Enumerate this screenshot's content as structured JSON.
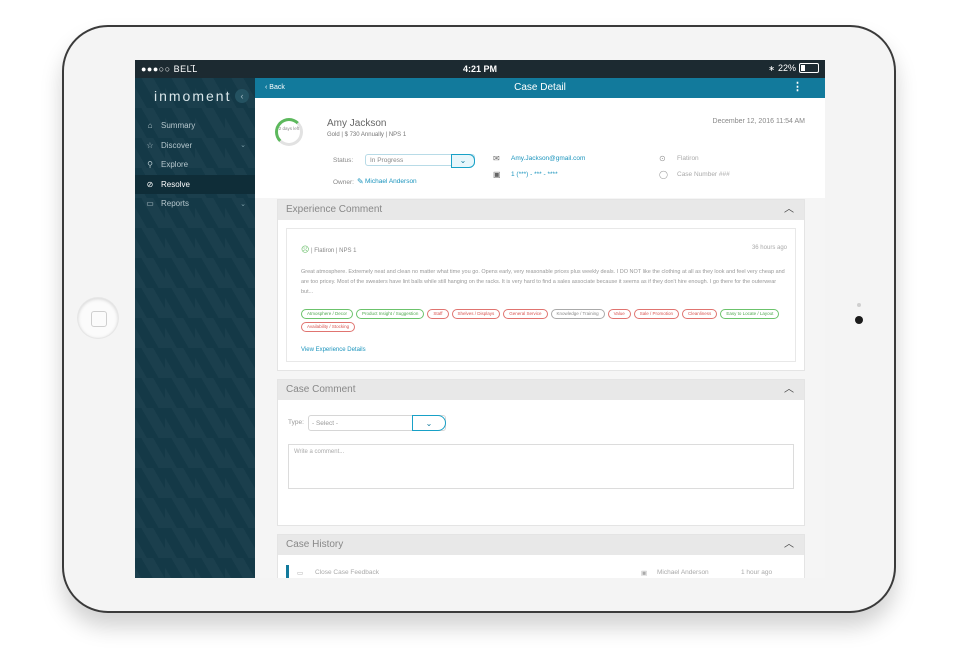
{
  "status_bar": {
    "carrier": "●●●○○ BELL",
    "wifi_icon": "wifi-icon",
    "time": "4:21 PM",
    "battery": "22%",
    "battery_level": 0.22
  },
  "sidebar": {
    "brand": "inmoment",
    "collapse_icon": "chevron-left-icon",
    "items": [
      {
        "label": "Summary",
        "icon": "home-icon",
        "active": false,
        "expandable": false
      },
      {
        "label": "Discover",
        "icon": "star-icon",
        "active": false,
        "expandable": true
      },
      {
        "label": "Explore",
        "icon": "flashlight-icon",
        "active": false,
        "expandable": false
      },
      {
        "label": "Resolve",
        "icon": "check-circle-icon",
        "active": true,
        "expandable": false
      },
      {
        "label": "Reports",
        "icon": "folder-icon",
        "active": false,
        "expandable": true
      }
    ]
  },
  "topbar": {
    "back": "‹ Back",
    "title": "Case Detail",
    "menu_icon": "more-vertical-icon"
  },
  "case": {
    "days_left": "2 days left",
    "name": "Amy Jackson",
    "info": "Gold | $ 730 Annually | NPS 1",
    "date": "December 12, 2016 11:54 AM",
    "status_label": "Status:",
    "status_value": "In Progress",
    "owner_label": "Owner:",
    "owner_value": "Michael Anderson",
    "email": "Amy.Jackson@gmail.com",
    "phone": "1 (***) - *** - ****",
    "location": "Flatiron",
    "case_number": "Case Number ###"
  },
  "experience": {
    "title": "Experience Comment",
    "meta": "| Flatiron | NPS 1",
    "age": "36 hours ago",
    "text": "Great atmosphere. Extremely neat and clean no matter what time you go. Opens early, very reasonable prices plus weekly deals. I DO NOT like the clothing at all as they look and feel very cheap and are too pricey. Most of the sweaters have lint balls while still hanging on the racks. It is very hard to find a sales associate because it seems as if they don't hire enough. I go there for the outerwear but...",
    "tags": [
      {
        "label": "Atmosphere / Decor",
        "sentiment": "pos"
      },
      {
        "label": "Product Insight / Suggestion",
        "sentiment": "pos"
      },
      {
        "label": "Staff",
        "sentiment": "neg"
      },
      {
        "label": "Shelves / Displays",
        "sentiment": "neg"
      },
      {
        "label": "General Service",
        "sentiment": "neg"
      },
      {
        "label": "Knowledge / Training",
        "sentiment": "neu"
      },
      {
        "label": "Value",
        "sentiment": "neg"
      },
      {
        "label": "Sale / Promotion",
        "sentiment": "neg"
      },
      {
        "label": "Cleanliness",
        "sentiment": "neg"
      },
      {
        "label": "Easy to Locate / Layout",
        "sentiment": "pos"
      },
      {
        "label": "Availability / Stocking",
        "sentiment": "neg"
      }
    ],
    "view_link": "View Experience Details"
  },
  "case_comment": {
    "title": "Case Comment",
    "type_label": "Type:",
    "type_value": "- Select -",
    "placeholder": "Write a comment..."
  },
  "case_history": {
    "title": "Case History",
    "row": {
      "event": "Close Case Feedback",
      "user": "Michael Anderson",
      "time": "1 hour ago"
    }
  }
}
